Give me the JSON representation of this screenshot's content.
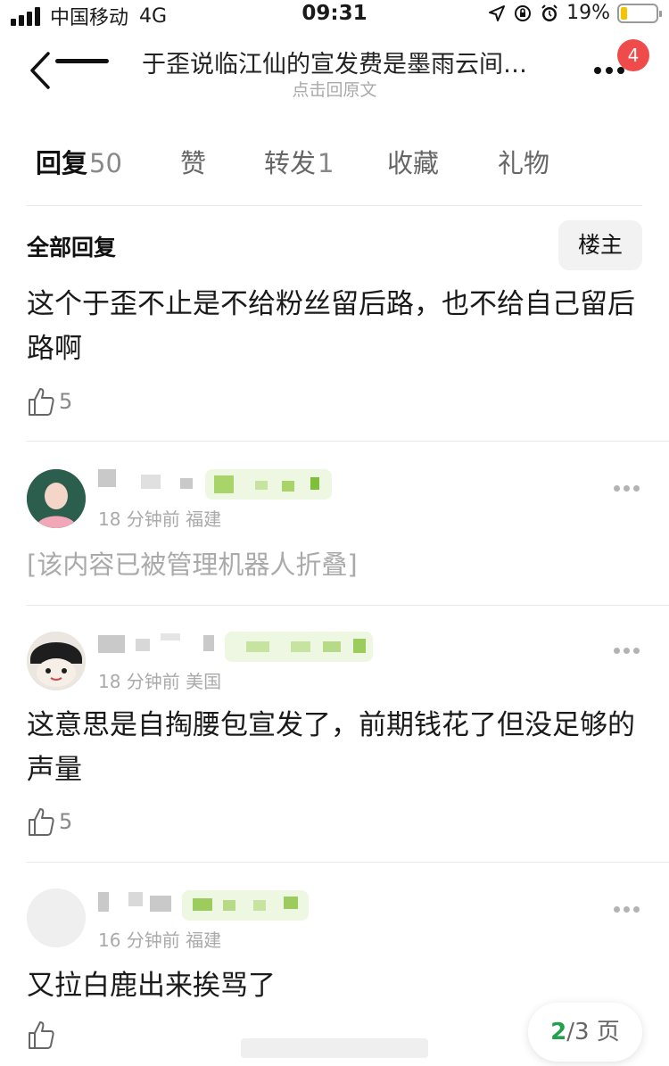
{
  "status_bar": {
    "carrier": "中国移动",
    "network": "4G",
    "time": "09:31",
    "battery": "19%",
    "battery_level": 0.19,
    "battery_color": "#f5c400"
  },
  "header": {
    "title": "于歪说临江仙的宣发费是墨雨云间…",
    "subtitle": "点击回原文",
    "notification_count": "4",
    "back_icon": "chevron-left-icon",
    "more_icon": "more-dots-icon"
  },
  "tabs": [
    {
      "label": "回复",
      "count": "50"
    },
    {
      "label": "赞",
      "count": ""
    },
    {
      "label": "转发",
      "count": "1"
    },
    {
      "label": "收藏",
      "count": ""
    },
    {
      "label": "礼物",
      "count": ""
    }
  ],
  "section": {
    "title": "全部回复",
    "owner_filter_label": "楼主"
  },
  "comments": [
    {
      "text": "这个于歪不止是不给粉丝留后路，也不给自己留后路啊",
      "likes": "5"
    },
    {
      "meta": "18 分钟前  福建",
      "folded_text": "[该内容已被管理机器人折叠]"
    },
    {
      "meta": "18 分钟前  美国",
      "text": "这意思是自掏腰包宣发了，前期钱花了但没足够的声量",
      "likes": "5"
    },
    {
      "meta": "16 分钟前  福建",
      "text": "又拉白鹿出来挨骂了",
      "likes": ""
    }
  ],
  "pagination": {
    "current": "2",
    "total": "/3 页"
  },
  "colors": {
    "accent_green": "#22a04b",
    "badge_red": "#f04b4b"
  }
}
